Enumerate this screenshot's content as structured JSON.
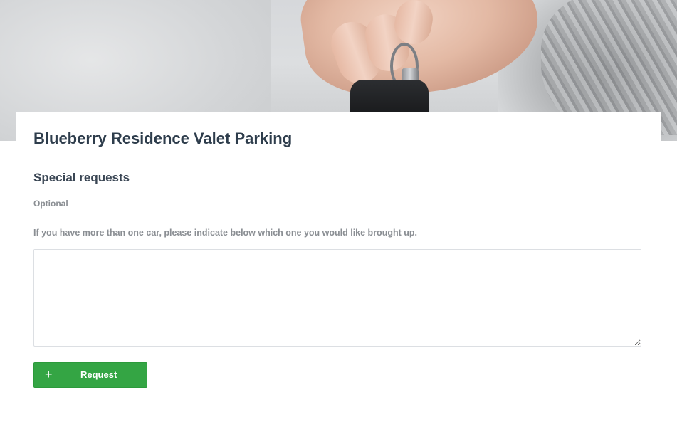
{
  "hero": {
    "image_name": "hand-holding-car-key-photo"
  },
  "form": {
    "title": "Blueberry Residence Valet Parking",
    "section_title": "Special requests",
    "optional_label": "Optional",
    "help_text": "If you have more than one car, please indicate below which one you would like brought up.",
    "textarea_value": "",
    "textarea_placeholder": ""
  },
  "actions": {
    "request_icon": "plus-icon",
    "request_icon_glyph": "+",
    "request_label": "Request"
  },
  "colors": {
    "title_text": "#2e3d4c",
    "muted_text": "#8a8e93",
    "button_green": "#34a544",
    "border": "#dcdfe3"
  }
}
